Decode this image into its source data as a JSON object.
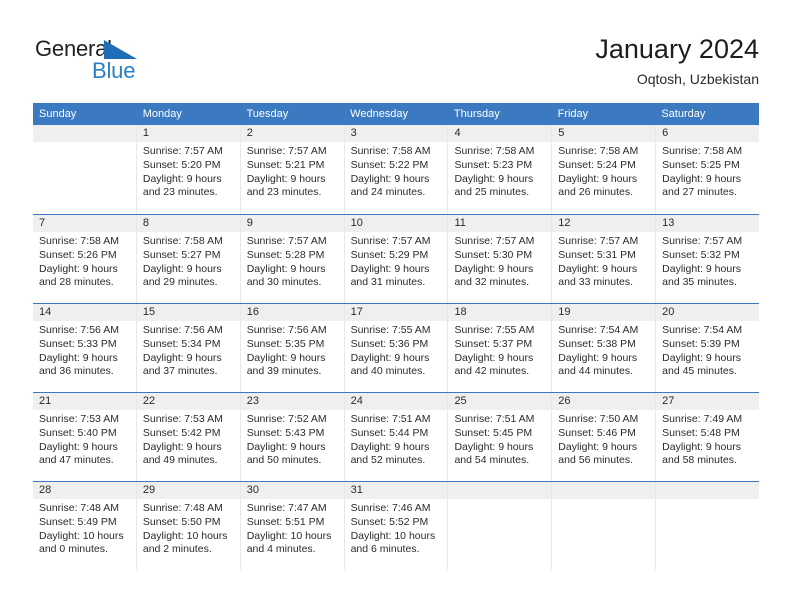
{
  "brand": {
    "word1": "General",
    "word2": "Blue",
    "triangle_color": "#1f6fb6",
    "word2_color": "#2b7fc4"
  },
  "header": {
    "title": "January 2024",
    "subtitle": "Oqtosh, Uzbekistan"
  },
  "theme": {
    "header_blue": "#3b7ac0",
    "daynum_band": "#efefef",
    "text": "#2b2b2b"
  },
  "weekdays": [
    "Sunday",
    "Monday",
    "Tuesday",
    "Wednesday",
    "Thursday",
    "Friday",
    "Saturday"
  ],
  "weeks": [
    [
      {
        "day": "",
        "sunrise": "",
        "sunset": "",
        "daylight1": "",
        "daylight2": ""
      },
      {
        "day": "1",
        "sunrise": "Sunrise: 7:57 AM",
        "sunset": "Sunset: 5:20 PM",
        "daylight1": "Daylight: 9 hours",
        "daylight2": "and 23 minutes."
      },
      {
        "day": "2",
        "sunrise": "Sunrise: 7:57 AM",
        "sunset": "Sunset: 5:21 PM",
        "daylight1": "Daylight: 9 hours",
        "daylight2": "and 23 minutes."
      },
      {
        "day": "3",
        "sunrise": "Sunrise: 7:58 AM",
        "sunset": "Sunset: 5:22 PM",
        "daylight1": "Daylight: 9 hours",
        "daylight2": "and 24 minutes."
      },
      {
        "day": "4",
        "sunrise": "Sunrise: 7:58 AM",
        "sunset": "Sunset: 5:23 PM",
        "daylight1": "Daylight: 9 hours",
        "daylight2": "and 25 minutes."
      },
      {
        "day": "5",
        "sunrise": "Sunrise: 7:58 AM",
        "sunset": "Sunset: 5:24 PM",
        "daylight1": "Daylight: 9 hours",
        "daylight2": "and 26 minutes."
      },
      {
        "day": "6",
        "sunrise": "Sunrise: 7:58 AM",
        "sunset": "Sunset: 5:25 PM",
        "daylight1": "Daylight: 9 hours",
        "daylight2": "and 27 minutes."
      }
    ],
    [
      {
        "day": "7",
        "sunrise": "Sunrise: 7:58 AM",
        "sunset": "Sunset: 5:26 PM",
        "daylight1": "Daylight: 9 hours",
        "daylight2": "and 28 minutes."
      },
      {
        "day": "8",
        "sunrise": "Sunrise: 7:58 AM",
        "sunset": "Sunset: 5:27 PM",
        "daylight1": "Daylight: 9 hours",
        "daylight2": "and 29 minutes."
      },
      {
        "day": "9",
        "sunrise": "Sunrise: 7:57 AM",
        "sunset": "Sunset: 5:28 PM",
        "daylight1": "Daylight: 9 hours",
        "daylight2": "and 30 minutes."
      },
      {
        "day": "10",
        "sunrise": "Sunrise: 7:57 AM",
        "sunset": "Sunset: 5:29 PM",
        "daylight1": "Daylight: 9 hours",
        "daylight2": "and 31 minutes."
      },
      {
        "day": "11",
        "sunrise": "Sunrise: 7:57 AM",
        "sunset": "Sunset: 5:30 PM",
        "daylight1": "Daylight: 9 hours",
        "daylight2": "and 32 minutes."
      },
      {
        "day": "12",
        "sunrise": "Sunrise: 7:57 AM",
        "sunset": "Sunset: 5:31 PM",
        "daylight1": "Daylight: 9 hours",
        "daylight2": "and 33 minutes."
      },
      {
        "day": "13",
        "sunrise": "Sunrise: 7:57 AM",
        "sunset": "Sunset: 5:32 PM",
        "daylight1": "Daylight: 9 hours",
        "daylight2": "and 35 minutes."
      }
    ],
    [
      {
        "day": "14",
        "sunrise": "Sunrise: 7:56 AM",
        "sunset": "Sunset: 5:33 PM",
        "daylight1": "Daylight: 9 hours",
        "daylight2": "and 36 minutes."
      },
      {
        "day": "15",
        "sunrise": "Sunrise: 7:56 AM",
        "sunset": "Sunset: 5:34 PM",
        "daylight1": "Daylight: 9 hours",
        "daylight2": "and 37 minutes."
      },
      {
        "day": "16",
        "sunrise": "Sunrise: 7:56 AM",
        "sunset": "Sunset: 5:35 PM",
        "daylight1": "Daylight: 9 hours",
        "daylight2": "and 39 minutes."
      },
      {
        "day": "17",
        "sunrise": "Sunrise: 7:55 AM",
        "sunset": "Sunset: 5:36 PM",
        "daylight1": "Daylight: 9 hours",
        "daylight2": "and 40 minutes."
      },
      {
        "day": "18",
        "sunrise": "Sunrise: 7:55 AM",
        "sunset": "Sunset: 5:37 PM",
        "daylight1": "Daylight: 9 hours",
        "daylight2": "and 42 minutes."
      },
      {
        "day": "19",
        "sunrise": "Sunrise: 7:54 AM",
        "sunset": "Sunset: 5:38 PM",
        "daylight1": "Daylight: 9 hours",
        "daylight2": "and 44 minutes."
      },
      {
        "day": "20",
        "sunrise": "Sunrise: 7:54 AM",
        "sunset": "Sunset: 5:39 PM",
        "daylight1": "Daylight: 9 hours",
        "daylight2": "and 45 minutes."
      }
    ],
    [
      {
        "day": "21",
        "sunrise": "Sunrise: 7:53 AM",
        "sunset": "Sunset: 5:40 PM",
        "daylight1": "Daylight: 9 hours",
        "daylight2": "and 47 minutes."
      },
      {
        "day": "22",
        "sunrise": "Sunrise: 7:53 AM",
        "sunset": "Sunset: 5:42 PM",
        "daylight1": "Daylight: 9 hours",
        "daylight2": "and 49 minutes."
      },
      {
        "day": "23",
        "sunrise": "Sunrise: 7:52 AM",
        "sunset": "Sunset: 5:43 PM",
        "daylight1": "Daylight: 9 hours",
        "daylight2": "and 50 minutes."
      },
      {
        "day": "24",
        "sunrise": "Sunrise: 7:51 AM",
        "sunset": "Sunset: 5:44 PM",
        "daylight1": "Daylight: 9 hours",
        "daylight2": "and 52 minutes."
      },
      {
        "day": "25",
        "sunrise": "Sunrise: 7:51 AM",
        "sunset": "Sunset: 5:45 PM",
        "daylight1": "Daylight: 9 hours",
        "daylight2": "and 54 minutes."
      },
      {
        "day": "26",
        "sunrise": "Sunrise: 7:50 AM",
        "sunset": "Sunset: 5:46 PM",
        "daylight1": "Daylight: 9 hours",
        "daylight2": "and 56 minutes."
      },
      {
        "day": "27",
        "sunrise": "Sunrise: 7:49 AM",
        "sunset": "Sunset: 5:48 PM",
        "daylight1": "Daylight: 9 hours",
        "daylight2": "and 58 minutes."
      }
    ],
    [
      {
        "day": "28",
        "sunrise": "Sunrise: 7:48 AM",
        "sunset": "Sunset: 5:49 PM",
        "daylight1": "Daylight: 10 hours",
        "daylight2": "and 0 minutes."
      },
      {
        "day": "29",
        "sunrise": "Sunrise: 7:48 AM",
        "sunset": "Sunset: 5:50 PM",
        "daylight1": "Daylight: 10 hours",
        "daylight2": "and 2 minutes."
      },
      {
        "day": "30",
        "sunrise": "Sunrise: 7:47 AM",
        "sunset": "Sunset: 5:51 PM",
        "daylight1": "Daylight: 10 hours",
        "daylight2": "and 4 minutes."
      },
      {
        "day": "31",
        "sunrise": "Sunrise: 7:46 AM",
        "sunset": "Sunset: 5:52 PM",
        "daylight1": "Daylight: 10 hours",
        "daylight2": "and 6 minutes."
      },
      {
        "day": "",
        "sunrise": "",
        "sunset": "",
        "daylight1": "",
        "daylight2": ""
      },
      {
        "day": "",
        "sunrise": "",
        "sunset": "",
        "daylight1": "",
        "daylight2": ""
      },
      {
        "day": "",
        "sunrise": "",
        "sunset": "",
        "daylight1": "",
        "daylight2": ""
      }
    ]
  ]
}
